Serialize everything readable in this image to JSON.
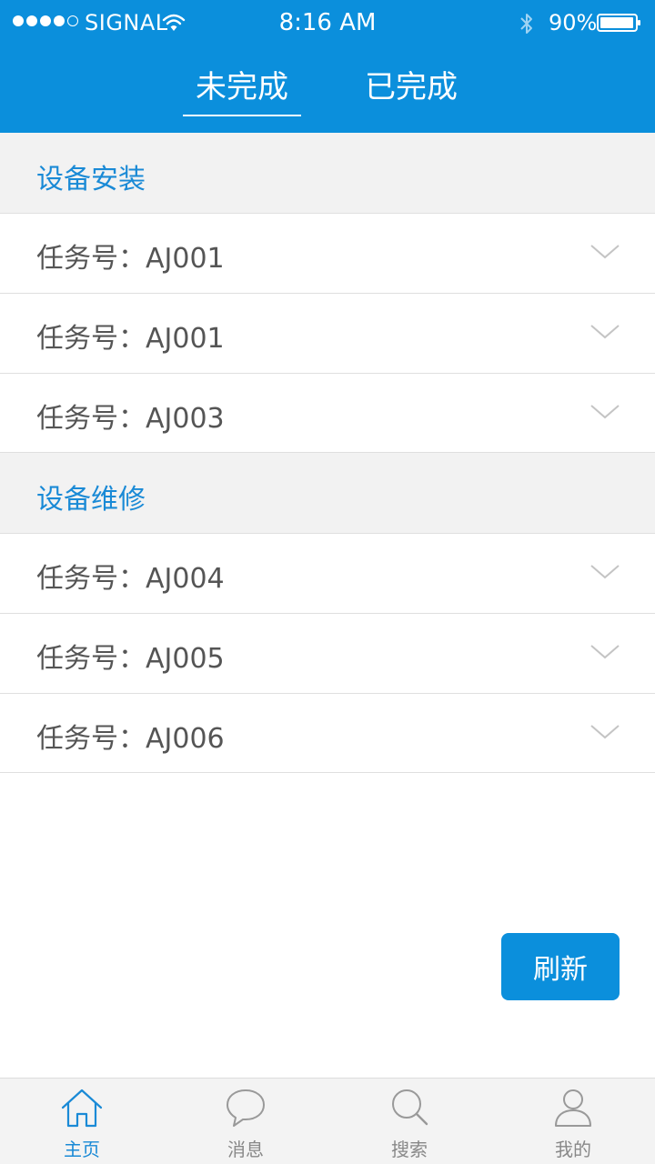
{
  "status_bar": {
    "carrier": "SIGNAL",
    "time": "8:16 AM",
    "battery": "90%"
  },
  "tabs": [
    {
      "label": "未完成",
      "active": true
    },
    {
      "label": "已完成",
      "active": false
    }
  ],
  "sections": [
    {
      "title": "设备安装",
      "tasks": [
        {
          "label": "任务号：AJ001"
        },
        {
          "label": "任务号：AJ001"
        },
        {
          "label": "任务号：AJ003"
        }
      ]
    },
    {
      "title": "设备维修",
      "tasks": [
        {
          "label": "任务号：AJ004"
        },
        {
          "label": "任务号：AJ005"
        },
        {
          "label": "任务号：AJ006"
        }
      ]
    }
  ],
  "refresh_label": "刷新",
  "bottom_nav": [
    {
      "label": "主页",
      "icon": "home-icon",
      "active": true
    },
    {
      "label": "消息",
      "icon": "chat-bubble-icon",
      "active": false
    },
    {
      "label": "搜索",
      "icon": "search-icon",
      "active": false
    },
    {
      "label": "我的",
      "icon": "user-icon",
      "active": false
    }
  ],
  "colors": {
    "primary": "#0b8fdc",
    "section_title": "#1a8ad6",
    "section_bg": "#f2f2f2",
    "task_text": "#555555",
    "nav_inactive": "#888888"
  }
}
